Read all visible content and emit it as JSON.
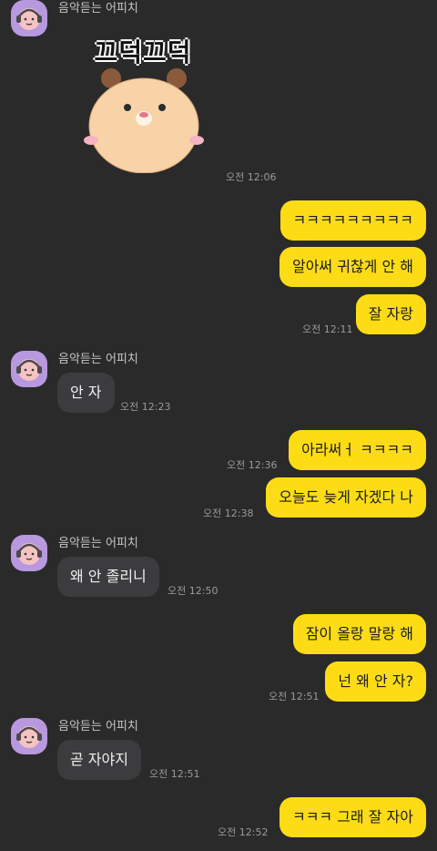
{
  "sender_name": "음악듣는 어피치",
  "sticker": {
    "text": "끄덕끄덕"
  },
  "messages": [
    {
      "kind": "sticker",
      "time": "오전 12:06"
    },
    {
      "text": "ㅋㅋㅋㅋㅋㅋㅋㅋㅋ"
    },
    {
      "text": "알아써 귀찮게 안 해"
    },
    {
      "text": "잘 자랑",
      "time": "오전 12:11"
    },
    {
      "text": "안 자",
      "time": "오전 12:23"
    },
    {
      "text": "아라써ㅓ ㅋㅋㅋㅋ",
      "time": "오전 12:36"
    },
    {
      "text": "오늘도 늦게 자겠다 나",
      "time": "오전 12:38"
    },
    {
      "text": "왜 안 졸리니",
      "time": "오전 12:50"
    },
    {
      "text": "잠이 올랑 말랑 해"
    },
    {
      "text": "넌 왜 안 자?",
      "time": "오전 12:51"
    },
    {
      "text": "곧 자야지",
      "time": "오전 12:51"
    },
    {
      "text": "ㅋㅋㅋ 그래 잘 자아",
      "time": "오전 12:52"
    }
  ],
  "colors": {
    "background": "#2a2a2b",
    "outgoing_bubble": "#fddc15",
    "incoming_bubble": "#3c3c3e",
    "avatar_bg": "#b898de"
  },
  "icons": {
    "avatar": "apeach-headphones-avatar",
    "sticker": "hamster-nodding-sticker"
  }
}
